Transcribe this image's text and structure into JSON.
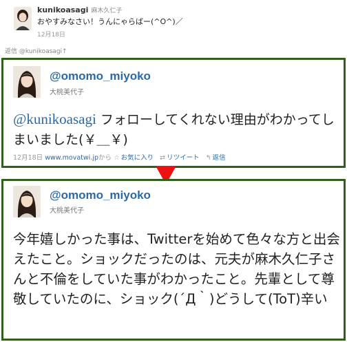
{
  "top_tweet": {
    "username": "kunikoasagi",
    "display_name": "麻木久仁子",
    "text": "おやすみなさい！うんにゃらばー(^O^)／",
    "date": "12月18日"
  },
  "reply_label": "返信 @kunikoasagi↑",
  "reply_tweet": {
    "handle": "@omomo_miyoko",
    "display_name": "大桃美代子",
    "mention": "@kunikoasagi",
    "text": " フォローしてくれない理由がわかってしまいました(￥＿￥)",
    "date": "12月18日",
    "via_link": "www.movatwi.jp",
    "via_suffix": "から",
    "favorite_label": "お気に入り",
    "retweet_label": "リツイート",
    "reply_label": "返信"
  },
  "main_tweet": {
    "handle": "@omomo_miyoko",
    "display_name": "大桃美代子",
    "text": "今年嬉しかった事は、Twitterを始めて色々な方と出会えたこと。ショックだったのは、元夫が麻木久仁子さんと不倫をしていた事がわかったこと。先輩として尊敬していたのに、ショック(´Д｀)どうして(ToT)辛い"
  },
  "colors": {
    "frame_green": "#2f5f1a",
    "link_blue": "#2b6aa6",
    "arrow_red": "#ee1111"
  },
  "icons": [
    "avatar-kunikoasagi",
    "avatar-omomo-miyoko",
    "star-icon",
    "retweet-icon",
    "reply-icon",
    "down-arrow-icon"
  ]
}
